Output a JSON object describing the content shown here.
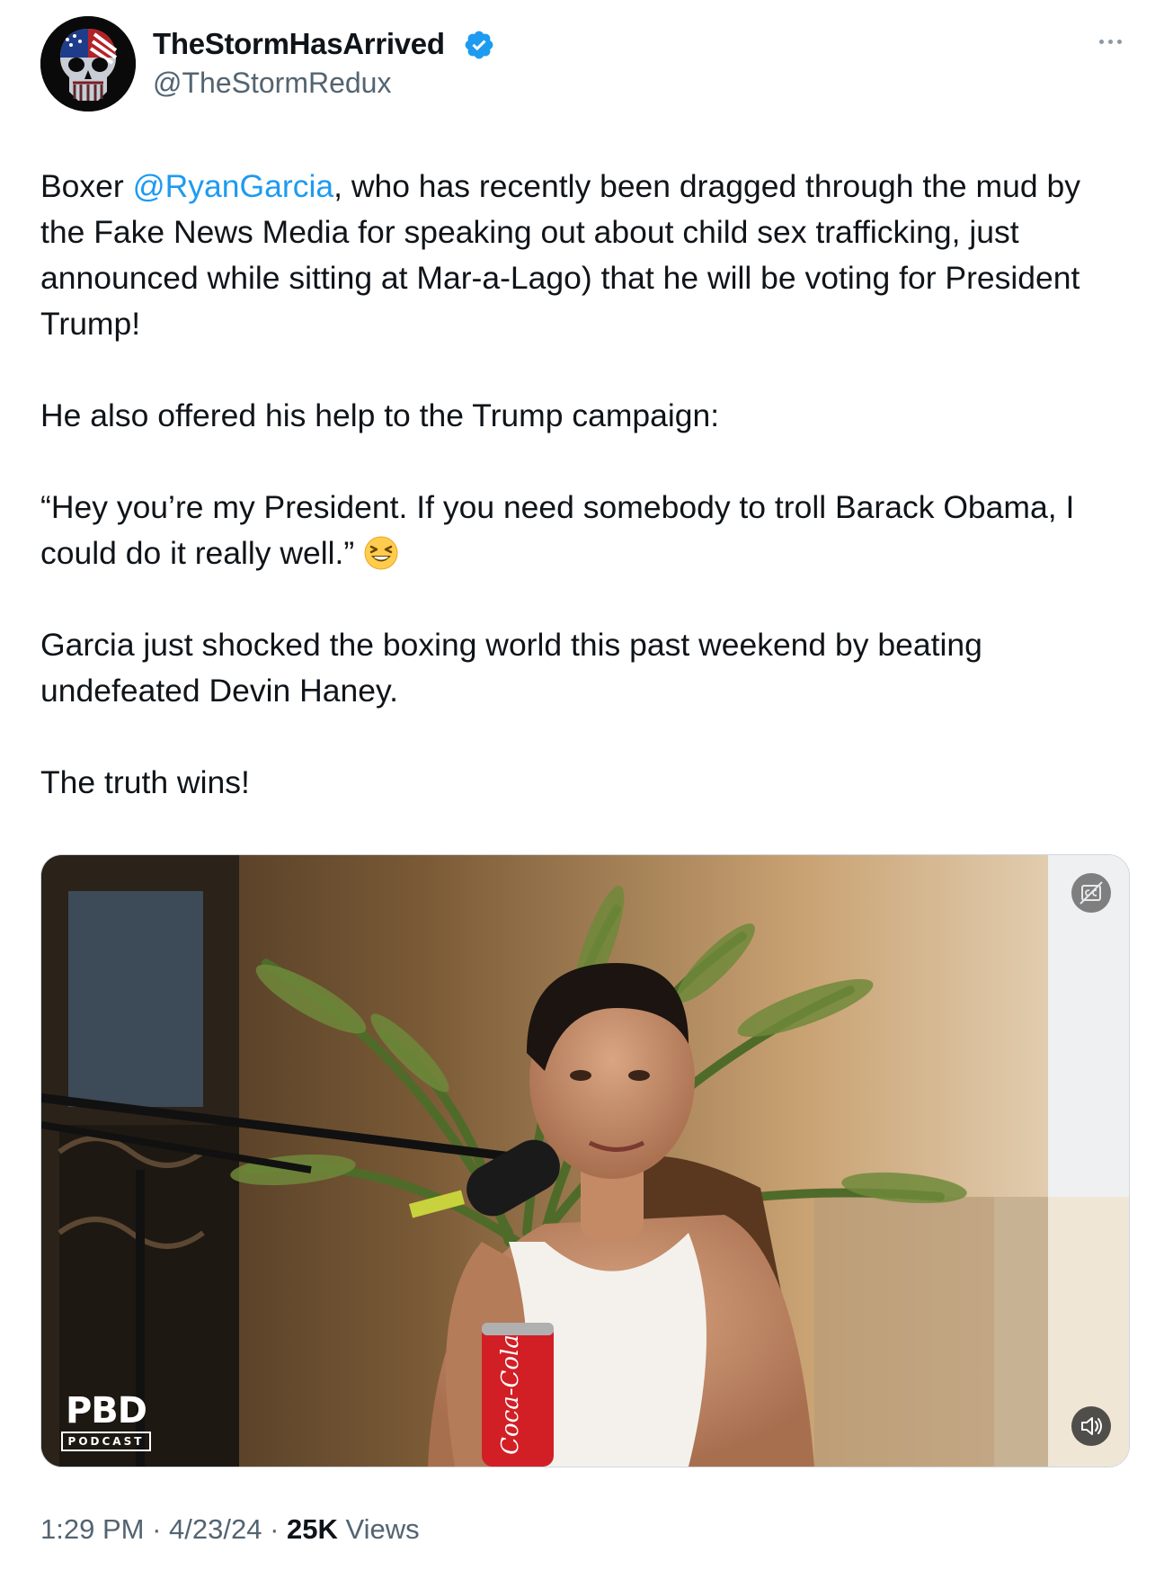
{
  "author": {
    "display_name": "TheStormHasArrived",
    "handle": "@TheStormRedux",
    "verified": true,
    "avatar_icon": "punisher-skull-flag-avatar"
  },
  "tweet": {
    "p1_before": "Boxer ",
    "mention": "@RyanGarcia",
    "p1_after": ", who has recently been dragged through the mud by the Fake News Media for speaking out about child sex trafficking, just announced while sitting at Mar-a-Lago) that he will be voting for President Trump!",
    "p2": "He also offered his help to the Trump campaign:",
    "p3": "“Hey you’re my President. If you need somebody to troll Barack Obama, I could do it really well.”",
    "p3_emoji": "laughing-squinting-face-emoji",
    "p4": "Garcia just shocked the boxing world this past weekend by beating undefeated Devin Haney.",
    "p5": "The truth wins!"
  },
  "media": {
    "type": "video",
    "logo_main": "PBD",
    "logo_sub": "PODCAST",
    "can_text": "Coca-Cola",
    "cc_icon": "captions-icon",
    "mute_icon": "speaker-icon"
  },
  "meta": {
    "time": "1:29 PM",
    "separator": "·",
    "date": "4/23/24",
    "views_count": "25K",
    "views_label": "Views"
  },
  "colors": {
    "link": "#1d9bf0",
    "text": "#0f1419",
    "secondary": "#536471",
    "verified": "#1d9bf0"
  }
}
